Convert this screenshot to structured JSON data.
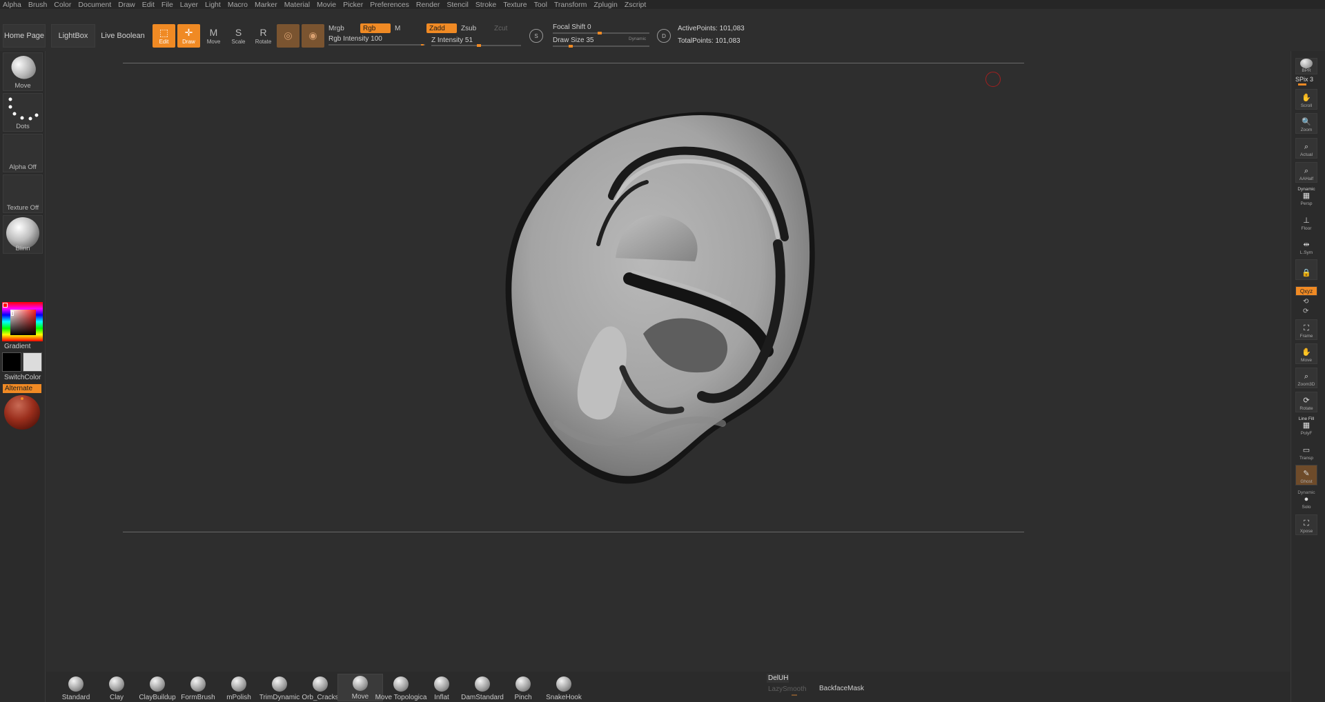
{
  "menu": [
    "Alpha",
    "Brush",
    "Color",
    "Document",
    "Draw",
    "Edit",
    "File",
    "Layer",
    "Light",
    "Macro",
    "Marker",
    "Material",
    "Movie",
    "Picker",
    "Preferences",
    "Render",
    "Stencil",
    "Stroke",
    "Texture",
    "Tool",
    "Transform",
    "Zplugin",
    "Zscript"
  ],
  "shelf": {
    "home_page": "Home Page",
    "lightbox": "LightBox",
    "live_boolean": "Live Boolean",
    "edit": "Edit",
    "draw": "Draw",
    "move": "Move",
    "scale": "Scale",
    "rotate": "Rotate",
    "mrgb": "Mrgb",
    "rgb": "Rgb",
    "m": "M",
    "rgb_intensity_label": "Rgb Intensity",
    "rgb_intensity_value": "100",
    "rgb_intensity_fraction": 1.0,
    "zadd": "Zadd",
    "zsub": "Zsub",
    "zcut": "Zcut",
    "z_intensity_label": "Z Intensity",
    "z_intensity_value": "51",
    "z_intensity_fraction": 0.51,
    "s_label": "S",
    "focal_shift_label": "Focal Shift",
    "focal_shift_value": "0",
    "draw_size_label": "Draw Size",
    "draw_size_value": "35",
    "dynamic": "Dynamic",
    "d_label": "D",
    "active_points": "ActivePoints: 101,083",
    "total_points": "TotalPoints: 101,083"
  },
  "left_tray": {
    "brush_label": "Move",
    "stroke_label": "Dots",
    "alpha_label": "Alpha Off",
    "texture_label": "Texture Off",
    "material_label": "Blinn",
    "gradient": "Gradient",
    "switch_color": "SwitchColor",
    "alternate": "Alternate"
  },
  "right_tray": {
    "bpr": "BPR",
    "spix": "SPix 3",
    "scroll": "Scroll",
    "zoom": "Zoom",
    "actual": "Actual",
    "aahalf": "AAHalf",
    "dynamic": "Dynamic",
    "persp": "Persp",
    "floor": "Floor",
    "lsym": "L.Sym",
    "qxyz": "Qxyz",
    "frame": "Frame",
    "move": "Move",
    "zoom3d": "Zoom3D",
    "rotate": "Rotate",
    "line_fill": "Line Fill",
    "polyf": "PolyF",
    "transp": "Transp",
    "ghost": "Ghost",
    "dynamic2": "Dynamic",
    "solo": "Solo",
    "xpose": "Xpose"
  },
  "brushes": [
    {
      "label": "Standard"
    },
    {
      "label": "Clay"
    },
    {
      "label": "ClayBuildup"
    },
    {
      "label": "FormBrush"
    },
    {
      "label": "mPolish"
    },
    {
      "label": "TrimDynamic"
    },
    {
      "label": "Orb_Cracks"
    },
    {
      "label": "Move"
    },
    {
      "label": "Move Topologica"
    },
    {
      "label": "Inflat"
    },
    {
      "label": "DamStandard"
    },
    {
      "label": "Pinch"
    },
    {
      "label": "SnakeHook"
    }
  ],
  "bottom": {
    "deluh": "DelUH",
    "lazysmooth": "LazySmooth",
    "backface_mask": "BackfaceMask"
  },
  "colors": {
    "accent": "#f08a24",
    "background": "#2b2b2b",
    "canvas": "#2e2e2e",
    "material_sphere": "#9a2e1c"
  }
}
